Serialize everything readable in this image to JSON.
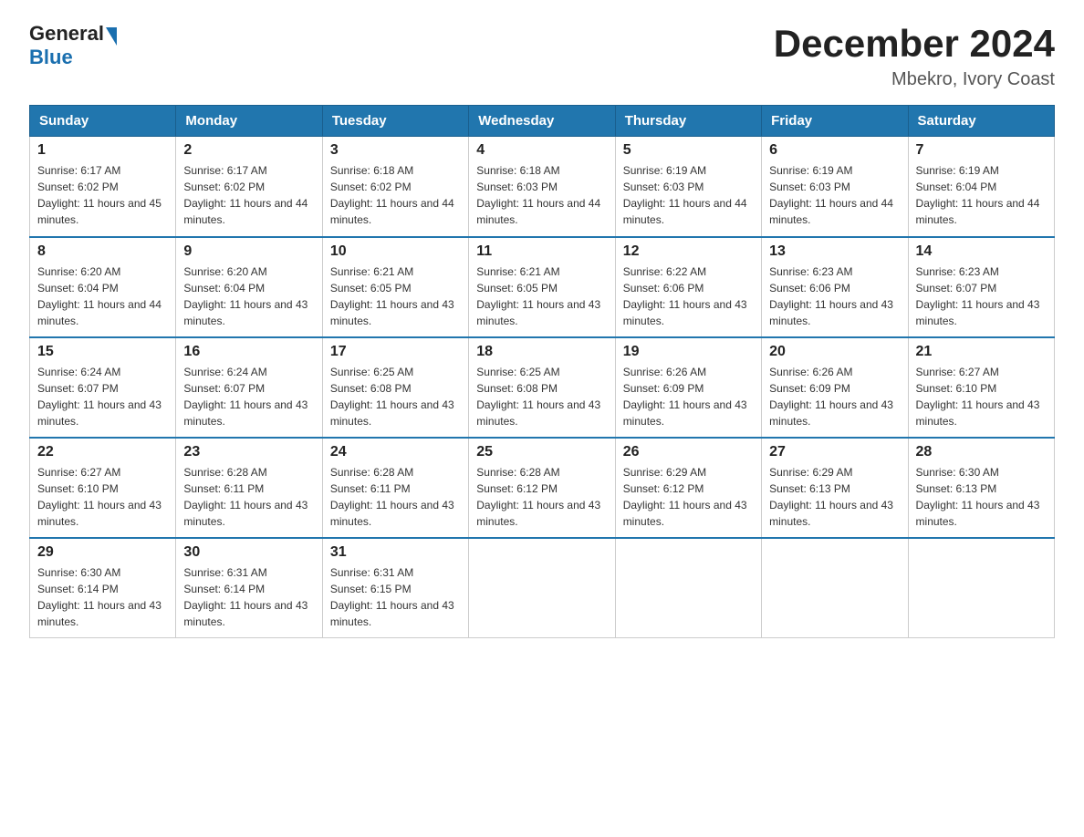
{
  "header": {
    "logo_general": "General",
    "logo_blue": "Blue",
    "title": "December 2024",
    "subtitle": "Mbekro, Ivory Coast"
  },
  "days_of_week": [
    "Sunday",
    "Monday",
    "Tuesday",
    "Wednesday",
    "Thursday",
    "Friday",
    "Saturday"
  ],
  "weeks": [
    [
      {
        "day": "1",
        "sunrise": "6:17 AM",
        "sunset": "6:02 PM",
        "daylight": "11 hours and 45 minutes."
      },
      {
        "day": "2",
        "sunrise": "6:17 AM",
        "sunset": "6:02 PM",
        "daylight": "11 hours and 44 minutes."
      },
      {
        "day": "3",
        "sunrise": "6:18 AM",
        "sunset": "6:02 PM",
        "daylight": "11 hours and 44 minutes."
      },
      {
        "day": "4",
        "sunrise": "6:18 AM",
        "sunset": "6:03 PM",
        "daylight": "11 hours and 44 minutes."
      },
      {
        "day": "5",
        "sunrise": "6:19 AM",
        "sunset": "6:03 PM",
        "daylight": "11 hours and 44 minutes."
      },
      {
        "day": "6",
        "sunrise": "6:19 AM",
        "sunset": "6:03 PM",
        "daylight": "11 hours and 44 minutes."
      },
      {
        "day": "7",
        "sunrise": "6:19 AM",
        "sunset": "6:04 PM",
        "daylight": "11 hours and 44 minutes."
      }
    ],
    [
      {
        "day": "8",
        "sunrise": "6:20 AM",
        "sunset": "6:04 PM",
        "daylight": "11 hours and 44 minutes."
      },
      {
        "day": "9",
        "sunrise": "6:20 AM",
        "sunset": "6:04 PM",
        "daylight": "11 hours and 43 minutes."
      },
      {
        "day": "10",
        "sunrise": "6:21 AM",
        "sunset": "6:05 PM",
        "daylight": "11 hours and 43 minutes."
      },
      {
        "day": "11",
        "sunrise": "6:21 AM",
        "sunset": "6:05 PM",
        "daylight": "11 hours and 43 minutes."
      },
      {
        "day": "12",
        "sunrise": "6:22 AM",
        "sunset": "6:06 PM",
        "daylight": "11 hours and 43 minutes."
      },
      {
        "day": "13",
        "sunrise": "6:23 AM",
        "sunset": "6:06 PM",
        "daylight": "11 hours and 43 minutes."
      },
      {
        "day": "14",
        "sunrise": "6:23 AM",
        "sunset": "6:07 PM",
        "daylight": "11 hours and 43 minutes."
      }
    ],
    [
      {
        "day": "15",
        "sunrise": "6:24 AM",
        "sunset": "6:07 PM",
        "daylight": "11 hours and 43 minutes."
      },
      {
        "day": "16",
        "sunrise": "6:24 AM",
        "sunset": "6:07 PM",
        "daylight": "11 hours and 43 minutes."
      },
      {
        "day": "17",
        "sunrise": "6:25 AM",
        "sunset": "6:08 PM",
        "daylight": "11 hours and 43 minutes."
      },
      {
        "day": "18",
        "sunrise": "6:25 AM",
        "sunset": "6:08 PM",
        "daylight": "11 hours and 43 minutes."
      },
      {
        "day": "19",
        "sunrise": "6:26 AM",
        "sunset": "6:09 PM",
        "daylight": "11 hours and 43 minutes."
      },
      {
        "day": "20",
        "sunrise": "6:26 AM",
        "sunset": "6:09 PM",
        "daylight": "11 hours and 43 minutes."
      },
      {
        "day": "21",
        "sunrise": "6:27 AM",
        "sunset": "6:10 PM",
        "daylight": "11 hours and 43 minutes."
      }
    ],
    [
      {
        "day": "22",
        "sunrise": "6:27 AM",
        "sunset": "6:10 PM",
        "daylight": "11 hours and 43 minutes."
      },
      {
        "day": "23",
        "sunrise": "6:28 AM",
        "sunset": "6:11 PM",
        "daylight": "11 hours and 43 minutes."
      },
      {
        "day": "24",
        "sunrise": "6:28 AM",
        "sunset": "6:11 PM",
        "daylight": "11 hours and 43 minutes."
      },
      {
        "day": "25",
        "sunrise": "6:28 AM",
        "sunset": "6:12 PM",
        "daylight": "11 hours and 43 minutes."
      },
      {
        "day": "26",
        "sunrise": "6:29 AM",
        "sunset": "6:12 PM",
        "daylight": "11 hours and 43 minutes."
      },
      {
        "day": "27",
        "sunrise": "6:29 AM",
        "sunset": "6:13 PM",
        "daylight": "11 hours and 43 minutes."
      },
      {
        "day": "28",
        "sunrise": "6:30 AM",
        "sunset": "6:13 PM",
        "daylight": "11 hours and 43 minutes."
      }
    ],
    [
      {
        "day": "29",
        "sunrise": "6:30 AM",
        "sunset": "6:14 PM",
        "daylight": "11 hours and 43 minutes."
      },
      {
        "day": "30",
        "sunrise": "6:31 AM",
        "sunset": "6:14 PM",
        "daylight": "11 hours and 43 minutes."
      },
      {
        "day": "31",
        "sunrise": "6:31 AM",
        "sunset": "6:15 PM",
        "daylight": "11 hours and 43 minutes."
      },
      null,
      null,
      null,
      null
    ]
  ],
  "labels": {
    "sunrise": "Sunrise:",
    "sunset": "Sunset:",
    "daylight": "Daylight:"
  }
}
